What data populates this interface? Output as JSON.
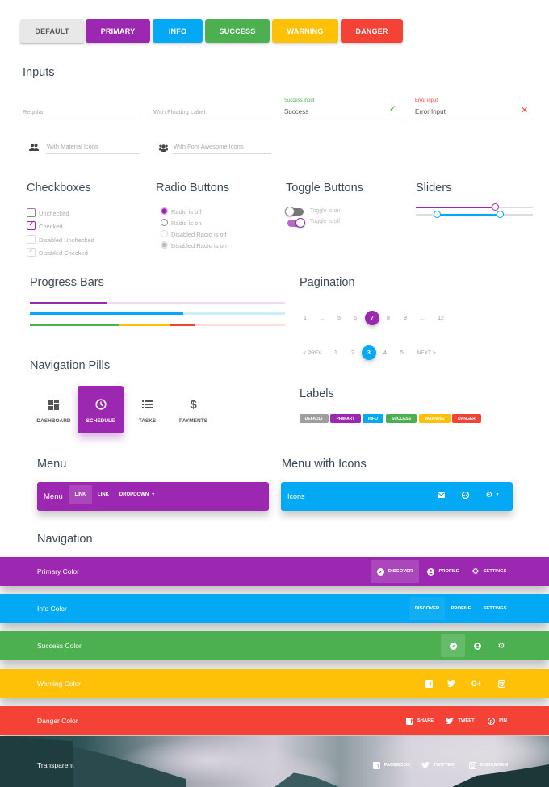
{
  "colors": {
    "default": "#e8e8e8",
    "primary": "#9c27b0",
    "info": "#03a9f4",
    "success": "#4caf50",
    "warning": "#ffc107",
    "danger": "#f44336",
    "label_default": "#9e9e9e"
  },
  "buttons": [
    {
      "label": "DEFAULT",
      "variant": "default"
    },
    {
      "label": "PRIMARY",
      "variant": "primary"
    },
    {
      "label": "INFO",
      "variant": "info"
    },
    {
      "label": "SUCCESS",
      "variant": "success"
    },
    {
      "label": "WARNING",
      "variant": "warning"
    },
    {
      "label": "DANGER",
      "variant": "danger"
    }
  ],
  "inputs": {
    "title": "Inputs",
    "regular_placeholder": "Regular",
    "floating_placeholder": "With Floating Label",
    "success_label": "Success input",
    "success_value": "Success",
    "error_label": "Error input",
    "error_value": "Error Input",
    "material_icons_placeholder": "With Material Icons",
    "font_awesome_placeholder": "With Font Awesome Icons",
    "icons": {
      "material": "group-icon",
      "font_awesome": "users-icon",
      "success": "check-icon",
      "error": "close-icon"
    }
  },
  "checkboxes": {
    "title": "Checkboxes",
    "items": [
      {
        "label": "Unchecked",
        "checked": false,
        "disabled": false
      },
      {
        "label": "Checked",
        "checked": true,
        "disabled": false
      },
      {
        "label": "Disabled Unchecked",
        "checked": false,
        "disabled": true
      },
      {
        "label": "Disabled Checked",
        "checked": true,
        "disabled": true
      }
    ]
  },
  "radios": {
    "title": "Radio Buttons",
    "items": [
      {
        "label": "Radio is off",
        "selected": true,
        "disabled": false
      },
      {
        "label": "Radio is on",
        "selected": false,
        "disabled": false
      },
      {
        "label": "Disabled Radio is off",
        "selected": false,
        "disabled": true
      },
      {
        "label": "Disabled Radio is on",
        "selected": true,
        "disabled": true
      }
    ]
  },
  "toggles": {
    "title": "Toggle Buttons",
    "items": [
      {
        "label": "Toggle is on",
        "on": false
      },
      {
        "label": "Toggle is off",
        "on": true
      }
    ]
  },
  "sliders": {
    "title": "Sliders",
    "single_value_pct": 68,
    "range_pct": [
      18,
      72
    ]
  },
  "progress": {
    "title": "Progress Bars",
    "bars": [
      {
        "color": "primary",
        "value_pct": 30
      },
      {
        "color": "info",
        "value_pct": 60
      },
      {
        "stacked": [
          {
            "color": "success",
            "value_pct": 35
          },
          {
            "color": "warning",
            "value_pct": 20
          },
          {
            "color": "danger",
            "value_pct": 10
          }
        ]
      }
    ]
  },
  "pagination": {
    "title": "Pagination",
    "row1": [
      "1",
      "...",
      "5",
      "6",
      "7",
      "8",
      "9",
      "...",
      "12"
    ],
    "row1_active": "7",
    "row2": [
      "< PREV",
      "1",
      "2",
      "3",
      "4",
      "5",
      "NEXT >"
    ],
    "row2_active": "3"
  },
  "pills": {
    "title": "Navigation Pills",
    "items": [
      {
        "label": "DASHBOARD",
        "icon": "dashboard-icon",
        "active": false
      },
      {
        "label": "SCHEDULE",
        "icon": "clock-icon",
        "active": true
      },
      {
        "label": "TASKS",
        "icon": "list-icon",
        "active": false
      },
      {
        "label": "PAYMENTS",
        "icon": "dollar-icon",
        "active": false
      }
    ]
  },
  "labels": {
    "title": "Labels",
    "items": [
      "DEFAULT",
      "PRIMARY",
      "INFO",
      "SUCCESS",
      "WARNING",
      "DANGER"
    ]
  },
  "menu": {
    "title": "Menu",
    "brand": "Menu",
    "links": [
      "LINK",
      "LINK",
      "DROPDOWN"
    ],
    "active_index": 0
  },
  "menu_icons": {
    "title": "Menu with Icons",
    "brand": "Icons",
    "icons": [
      "email-icon",
      "face-icon",
      "settings-icon"
    ]
  },
  "navigation": {
    "title": "Navigation",
    "bars": [
      {
        "brand": "Primary Color",
        "links": [
          "DISCOVER",
          "PROFILE",
          "SETTINGS"
        ]
      },
      {
        "brand": "Info Color",
        "links": [
          "DISCOVER",
          "PROFILE",
          "SETTINGS"
        ]
      },
      {
        "brand": "Success Color"
      },
      {
        "brand": "Warning Color"
      },
      {
        "brand": "Danger Color",
        "links": [
          "SHARE",
          "TWEET",
          "PIN"
        ]
      },
      {
        "brand": "Transparent",
        "links": [
          "FACEBOOK",
          "TWITTER",
          "INSTAGRAM"
        ]
      }
    ]
  }
}
